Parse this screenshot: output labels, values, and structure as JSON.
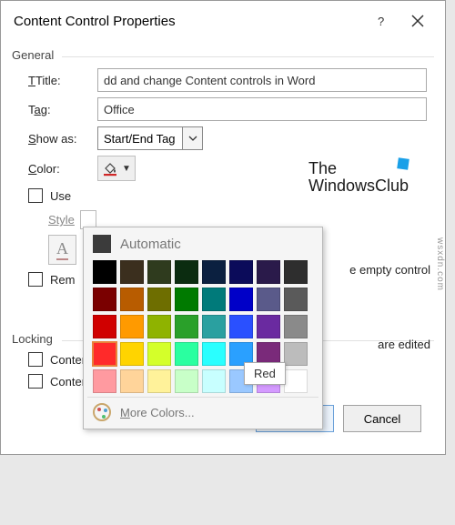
{
  "titlebar": {
    "title": "Content Control Properties"
  },
  "general": {
    "label": "General",
    "title_label": "Title:",
    "title_value": "dd and change Content controls in Word",
    "tag_label": "Tag:",
    "tag_value": "Office",
    "showas_label": "Show as:",
    "showas_value": "Start/End Tag",
    "color_label": "Color:",
    "use_style_label": "Use",
    "use_style_tail": "e empty control",
    "style_label": "Style",
    "newstyle_icon_letter": "A",
    "remove_label_left": "Rem",
    "remove_label_right": "are edited"
  },
  "watermark": {
    "line1": "The",
    "line2": "WindowsClub"
  },
  "locking": {
    "label": "Locking",
    "cannot_delete": "Content control cannot be deleted",
    "cannot_edit": "Contents cannot be edited"
  },
  "buttons": {
    "ok": "OK",
    "cancel": "Cancel"
  },
  "picker": {
    "automatic": "Automatic",
    "tooltip": "Red",
    "more": "More Colors...",
    "rows": [
      [
        "#000000",
        "#3b2f1e",
        "#2f3b1e",
        "#0b2c10",
        "#0b2040",
        "#0b0b5a",
        "#2a1a4a",
        "#2e2e2e"
      ],
      [
        "#7a0000",
        "#b85c00",
        "#6e6e00",
        "#007a00",
        "#007a7a",
        "#0000c8",
        "#5a5a8a",
        "#5a5a5a"
      ],
      [
        "#d00000",
        "#ff9a00",
        "#8fb300",
        "#2aa02a",
        "#2aa0a0",
        "#2a50ff",
        "#6a2aa0",
        "#8a8a8a"
      ],
      [
        "#ff2a2a",
        "#ffd400",
        "#d4ff2a",
        "#2affa0",
        "#2affff",
        "#2aa0ff",
        "#7a2a7a",
        "#bcbcbc"
      ],
      [
        "#ff9aa0",
        "#ffd49a",
        "#fff29a",
        "#c8ffc8",
        "#c8ffff",
        "#9ac8ff",
        "#d49aff",
        "#ffffff"
      ]
    ],
    "selected": {
      "r": 3,
      "c": 0
    }
  },
  "source_note": "wsxdn.com"
}
